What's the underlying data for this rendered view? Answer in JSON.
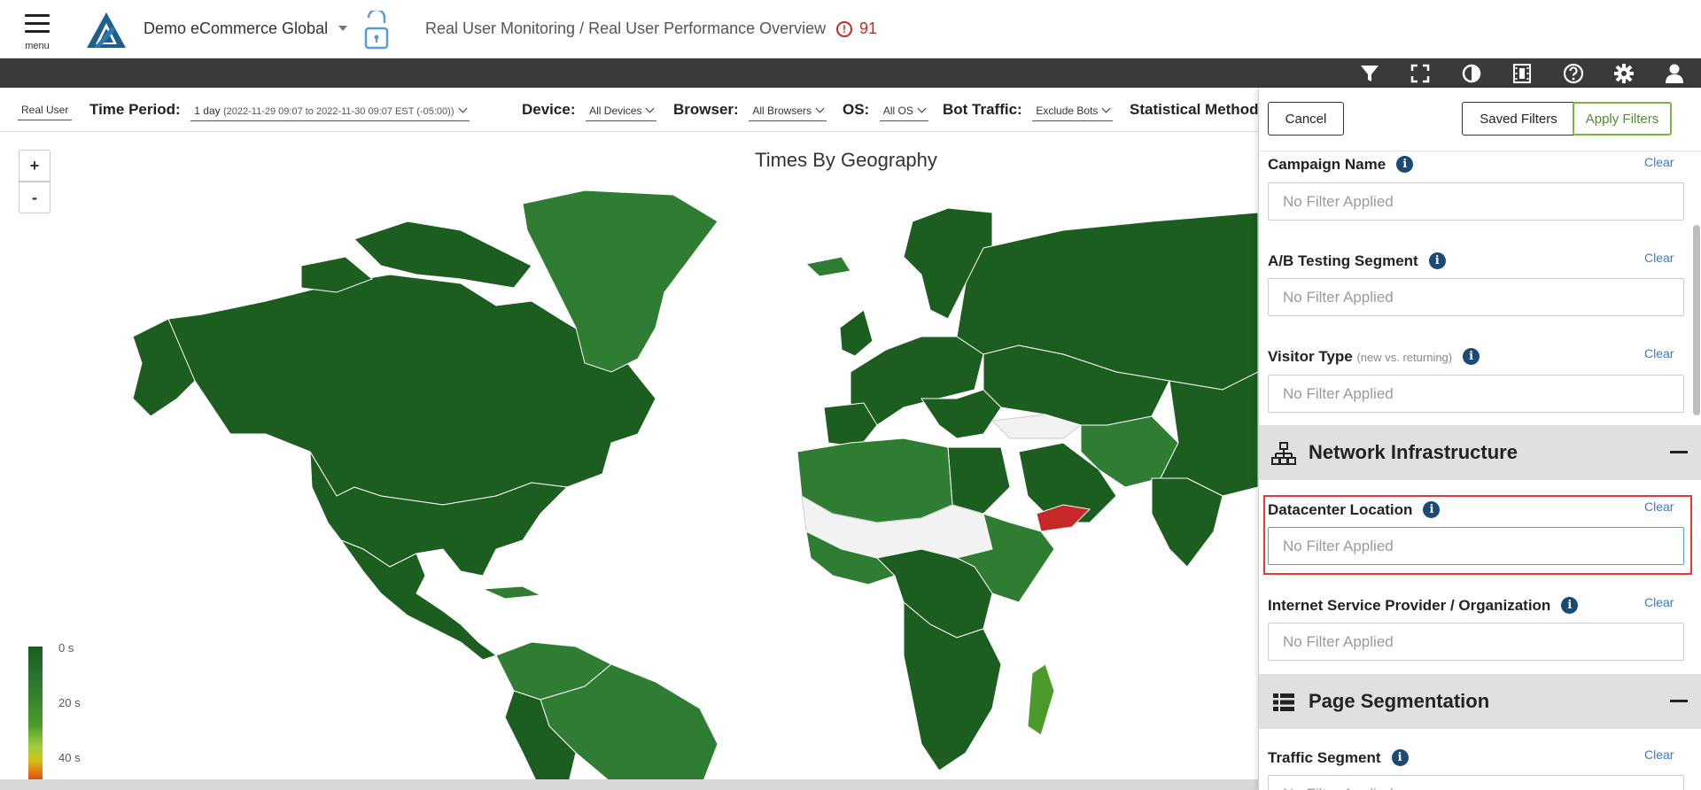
{
  "header": {
    "menu_label": "menu",
    "app_title": "Demo eCommerce Global",
    "breadcrumb": "Real User Monitoring / Real User Performance Overview",
    "alert_count": "91",
    "alert_icon_text": "!"
  },
  "toolbar": {
    "icons": [
      "filter-icon",
      "fullscreen-icon",
      "contrast-icon",
      "film-icon",
      "help-icon",
      "settings-icon",
      "user-icon"
    ]
  },
  "filters": {
    "mode_label": "Real User",
    "time_period_label": "Time Period:",
    "time_period_value": "1 day",
    "time_period_range": "(2022-11-29 09:07 to 2022-11-30 09:07 EST (-05:00))",
    "device_label": "Device:",
    "device_value": "All Devices",
    "browser_label": "Browser:",
    "browser_value": "All Browsers",
    "os_label": "OS:",
    "os_value": "All OS",
    "bot_label": "Bot Traffic:",
    "bot_value": "Exclude Bots",
    "stat_label": "Statistical Method"
  },
  "map": {
    "title": "Times By Geography",
    "zoom_in": "+",
    "zoom_out": "-",
    "legend": [
      "0 s",
      "20 s",
      "40 s"
    ],
    "colors": {
      "fast": "#1b5e20",
      "medium": "#2e7d32",
      "light": "#4c9a2a",
      "slow": "#c62828",
      "nodata": "#f2f2f2"
    }
  },
  "panel": {
    "cancel": "Cancel",
    "saved_filters": "Saved Filters",
    "apply_filters": "Apply Filters",
    "clear_label": "Clear",
    "info_glyph": "i",
    "placeholder": "No Filter Applied",
    "fields": {
      "campaign_name": "Campaign Name",
      "ab_segment": "A/B Testing Segment",
      "visitor_type": "Visitor Type",
      "visitor_type_sub": "(new vs. returning)",
      "datacenter": "Datacenter Location",
      "isp": "Internet Service Provider / Organization",
      "traffic_segment": "Traffic Segment"
    },
    "sections": {
      "network": "Network Infrastructure",
      "page_segmentation": "Page Segmentation"
    }
  }
}
